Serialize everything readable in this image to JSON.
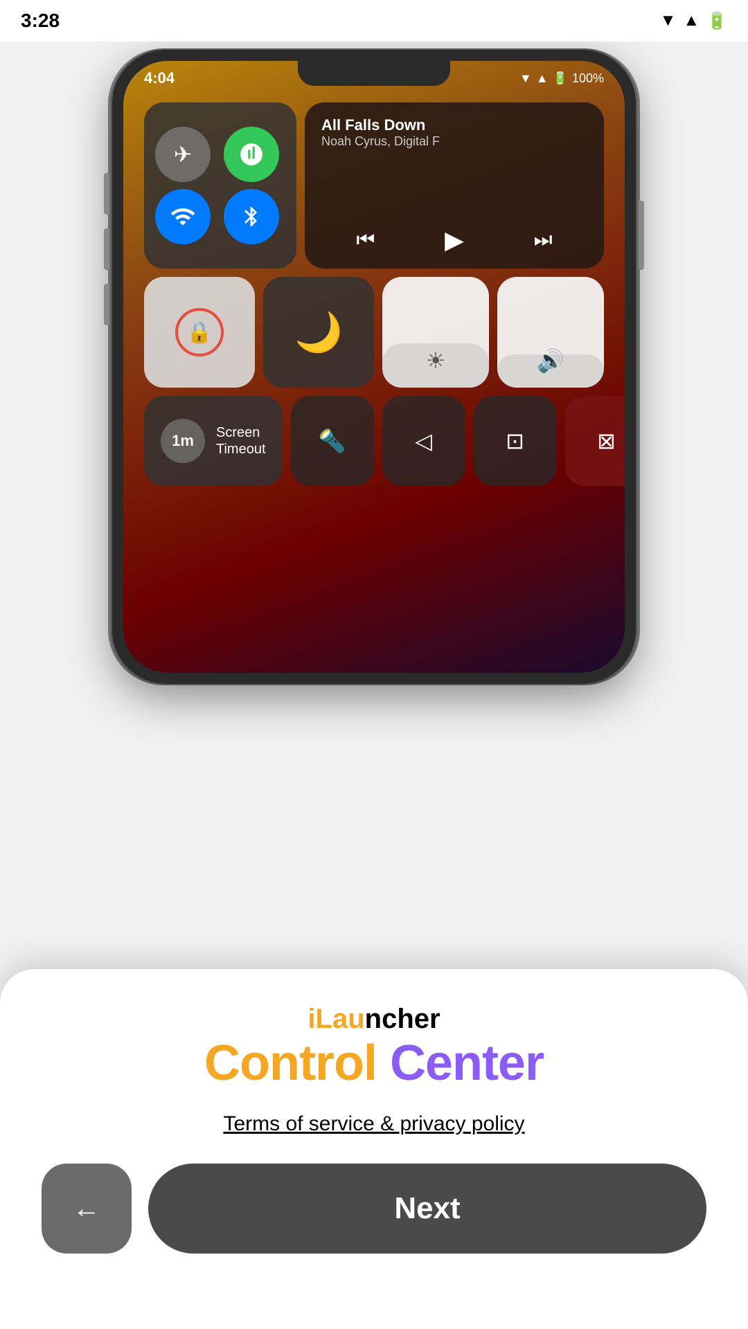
{
  "statusBar": {
    "time": "3:28",
    "icons": [
      "wifi",
      "signal",
      "battery"
    ]
  },
  "phone": {
    "time": "4:04",
    "battery": "100%",
    "music": {
      "title": "All Falls Down",
      "artist": "Noah Cyrus, Digital F"
    },
    "screenTimeout": {
      "value": "1m",
      "label": "Screen\nTimeout"
    }
  },
  "bottomSheet": {
    "appName": "iLauncher",
    "subtitle_orange": "Control",
    "subtitle_purple": "Center",
    "termsLabel": "Terms of service & privacy policy",
    "backLabel": "←",
    "nextLabel": "Next"
  }
}
